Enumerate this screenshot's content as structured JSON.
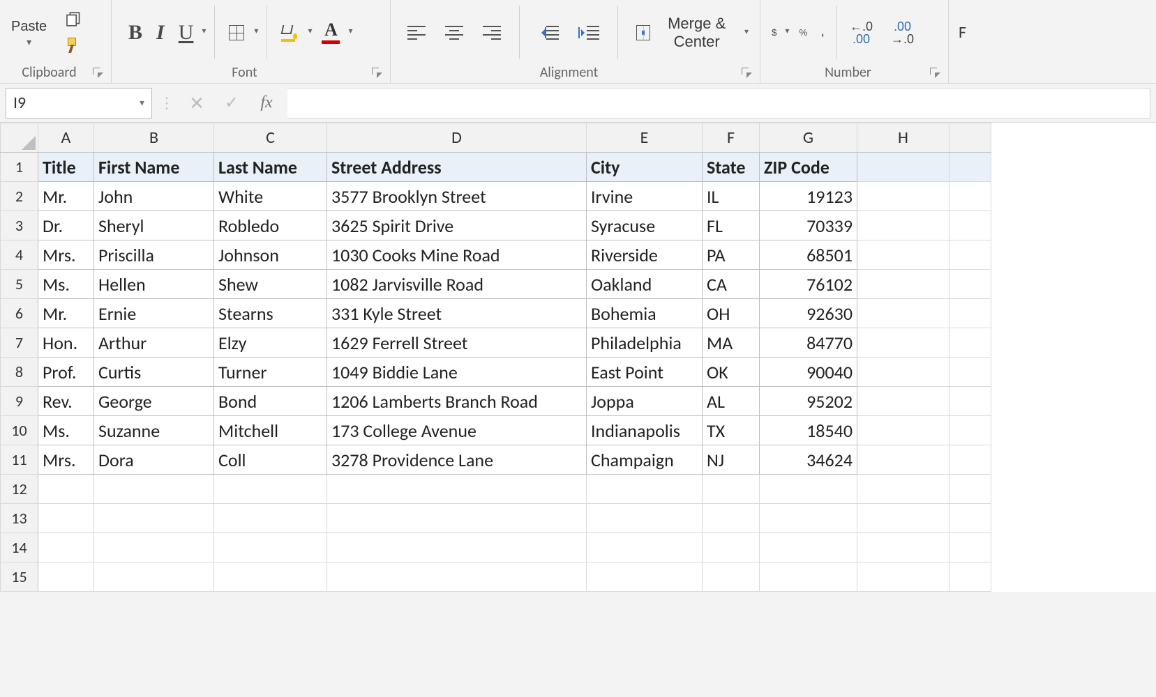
{
  "ribbon": {
    "clipboard": {
      "paste": "Paste",
      "group": "Clipboard"
    },
    "font": {
      "group": "Font",
      "bold": "B",
      "italic": "I",
      "underline": "U"
    },
    "alignment": {
      "group": "Alignment",
      "merge": "Merge & Center"
    },
    "number": {
      "group": "Number",
      "currency": "$",
      "percent": "%",
      "comma": ","
    },
    "format_label": "F"
  },
  "formula_bar": {
    "name_box": "I9",
    "fx": "fx",
    "value": ""
  },
  "grid": {
    "columns": [
      "A",
      "B",
      "C",
      "D",
      "E",
      "F",
      "G",
      "H"
    ],
    "headers": [
      "Title",
      "First Name",
      "Last Name",
      "Street Address",
      "City",
      "State",
      "ZIP Code"
    ],
    "rows": [
      {
        "title": "Mr.",
        "first": "John",
        "last": "White",
        "street": "3577 Brooklyn Street",
        "city": "Irvine",
        "state": "IL",
        "zip": "19123"
      },
      {
        "title": "Dr.",
        "first": "Sheryl",
        "last": "Robledo",
        "street": "3625 Spirit Drive",
        "city": "Syracuse",
        "state": "FL",
        "zip": "70339"
      },
      {
        "title": "Mrs.",
        "first": "Priscilla",
        "last": "Johnson",
        "street": "1030 Cooks Mine Road",
        "city": "Riverside",
        "state": "PA",
        "zip": "68501"
      },
      {
        "title": "Ms.",
        "first": "Hellen",
        "last": "Shew",
        "street": "1082 Jarvisville Road",
        "city": "Oakland",
        "state": "CA",
        "zip": "76102"
      },
      {
        "title": "Mr.",
        "first": "Ernie",
        "last": "Stearns",
        "street": "331 Kyle Street",
        "city": "Bohemia",
        "state": "OH",
        "zip": "92630"
      },
      {
        "title": "Hon.",
        "first": "Arthur",
        "last": "Elzy",
        "street": "1629 Ferrell Street",
        "city": "Philadelphia",
        "state": "MA",
        "zip": "84770"
      },
      {
        "title": "Prof.",
        "first": "Curtis",
        "last": "Turner",
        "street": "1049 Biddie Lane",
        "city": "East Point",
        "state": "OK",
        "zip": "90040"
      },
      {
        "title": "Rev.",
        "first": "George",
        "last": "Bond",
        "street": "1206 Lamberts Branch Road",
        "city": "Joppa",
        "state": "AL",
        "zip": "95202"
      },
      {
        "title": "Ms.",
        "first": "Suzanne",
        "last": "Mitchell",
        "street": "173 College Avenue",
        "city": "Indianapolis",
        "state": "TX",
        "zip": "18540"
      },
      {
        "title": "Mrs.",
        "first": "Dora",
        "last": "Coll",
        "street": "3278 Providence Lane",
        "city": "Champaign",
        "state": "NJ",
        "zip": "34624"
      }
    ],
    "empty_rows": [
      "12",
      "13",
      "14",
      "15"
    ]
  }
}
